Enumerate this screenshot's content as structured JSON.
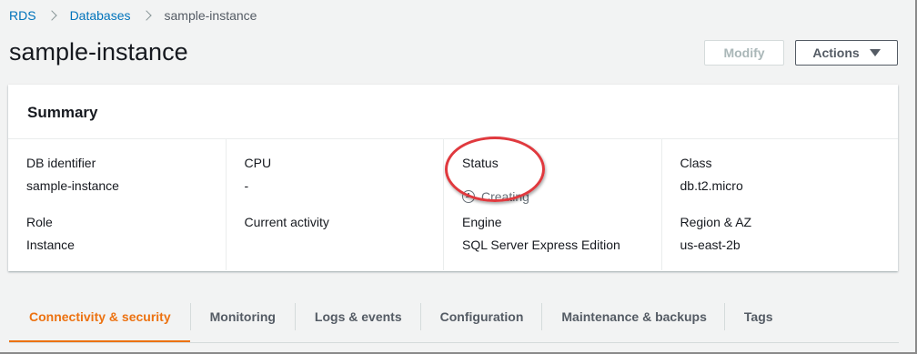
{
  "breadcrumb": {
    "items": [
      "RDS",
      "Databases"
    ],
    "current": "sample-instance"
  },
  "page": {
    "title": "sample-instance"
  },
  "header_buttons": {
    "modify": "Modify",
    "actions": "Actions"
  },
  "summary": {
    "title": "Summary",
    "columns": [
      {
        "label1": "DB identifier",
        "value1": "sample-instance",
        "label2": "Role",
        "value2": "Instance"
      },
      {
        "label1": "CPU",
        "value1": "-",
        "label2": "Current activity",
        "value2": ""
      },
      {
        "label1": "Status",
        "value1": "Creating",
        "label2": "Engine",
        "value2": "SQL Server Express Edition"
      },
      {
        "label1": "Class",
        "value1": "db.t2.micro",
        "label2": "Region & AZ",
        "value2": "us-east-2b"
      }
    ]
  },
  "tabs": [
    "Connectivity & security",
    "Monitoring",
    "Logs & events",
    "Configuration",
    "Maintenance & backups",
    "Tags"
  ],
  "colors": {
    "link": "#0073bb",
    "active_tab": "#ec7211",
    "highlight": "#e0393e"
  }
}
